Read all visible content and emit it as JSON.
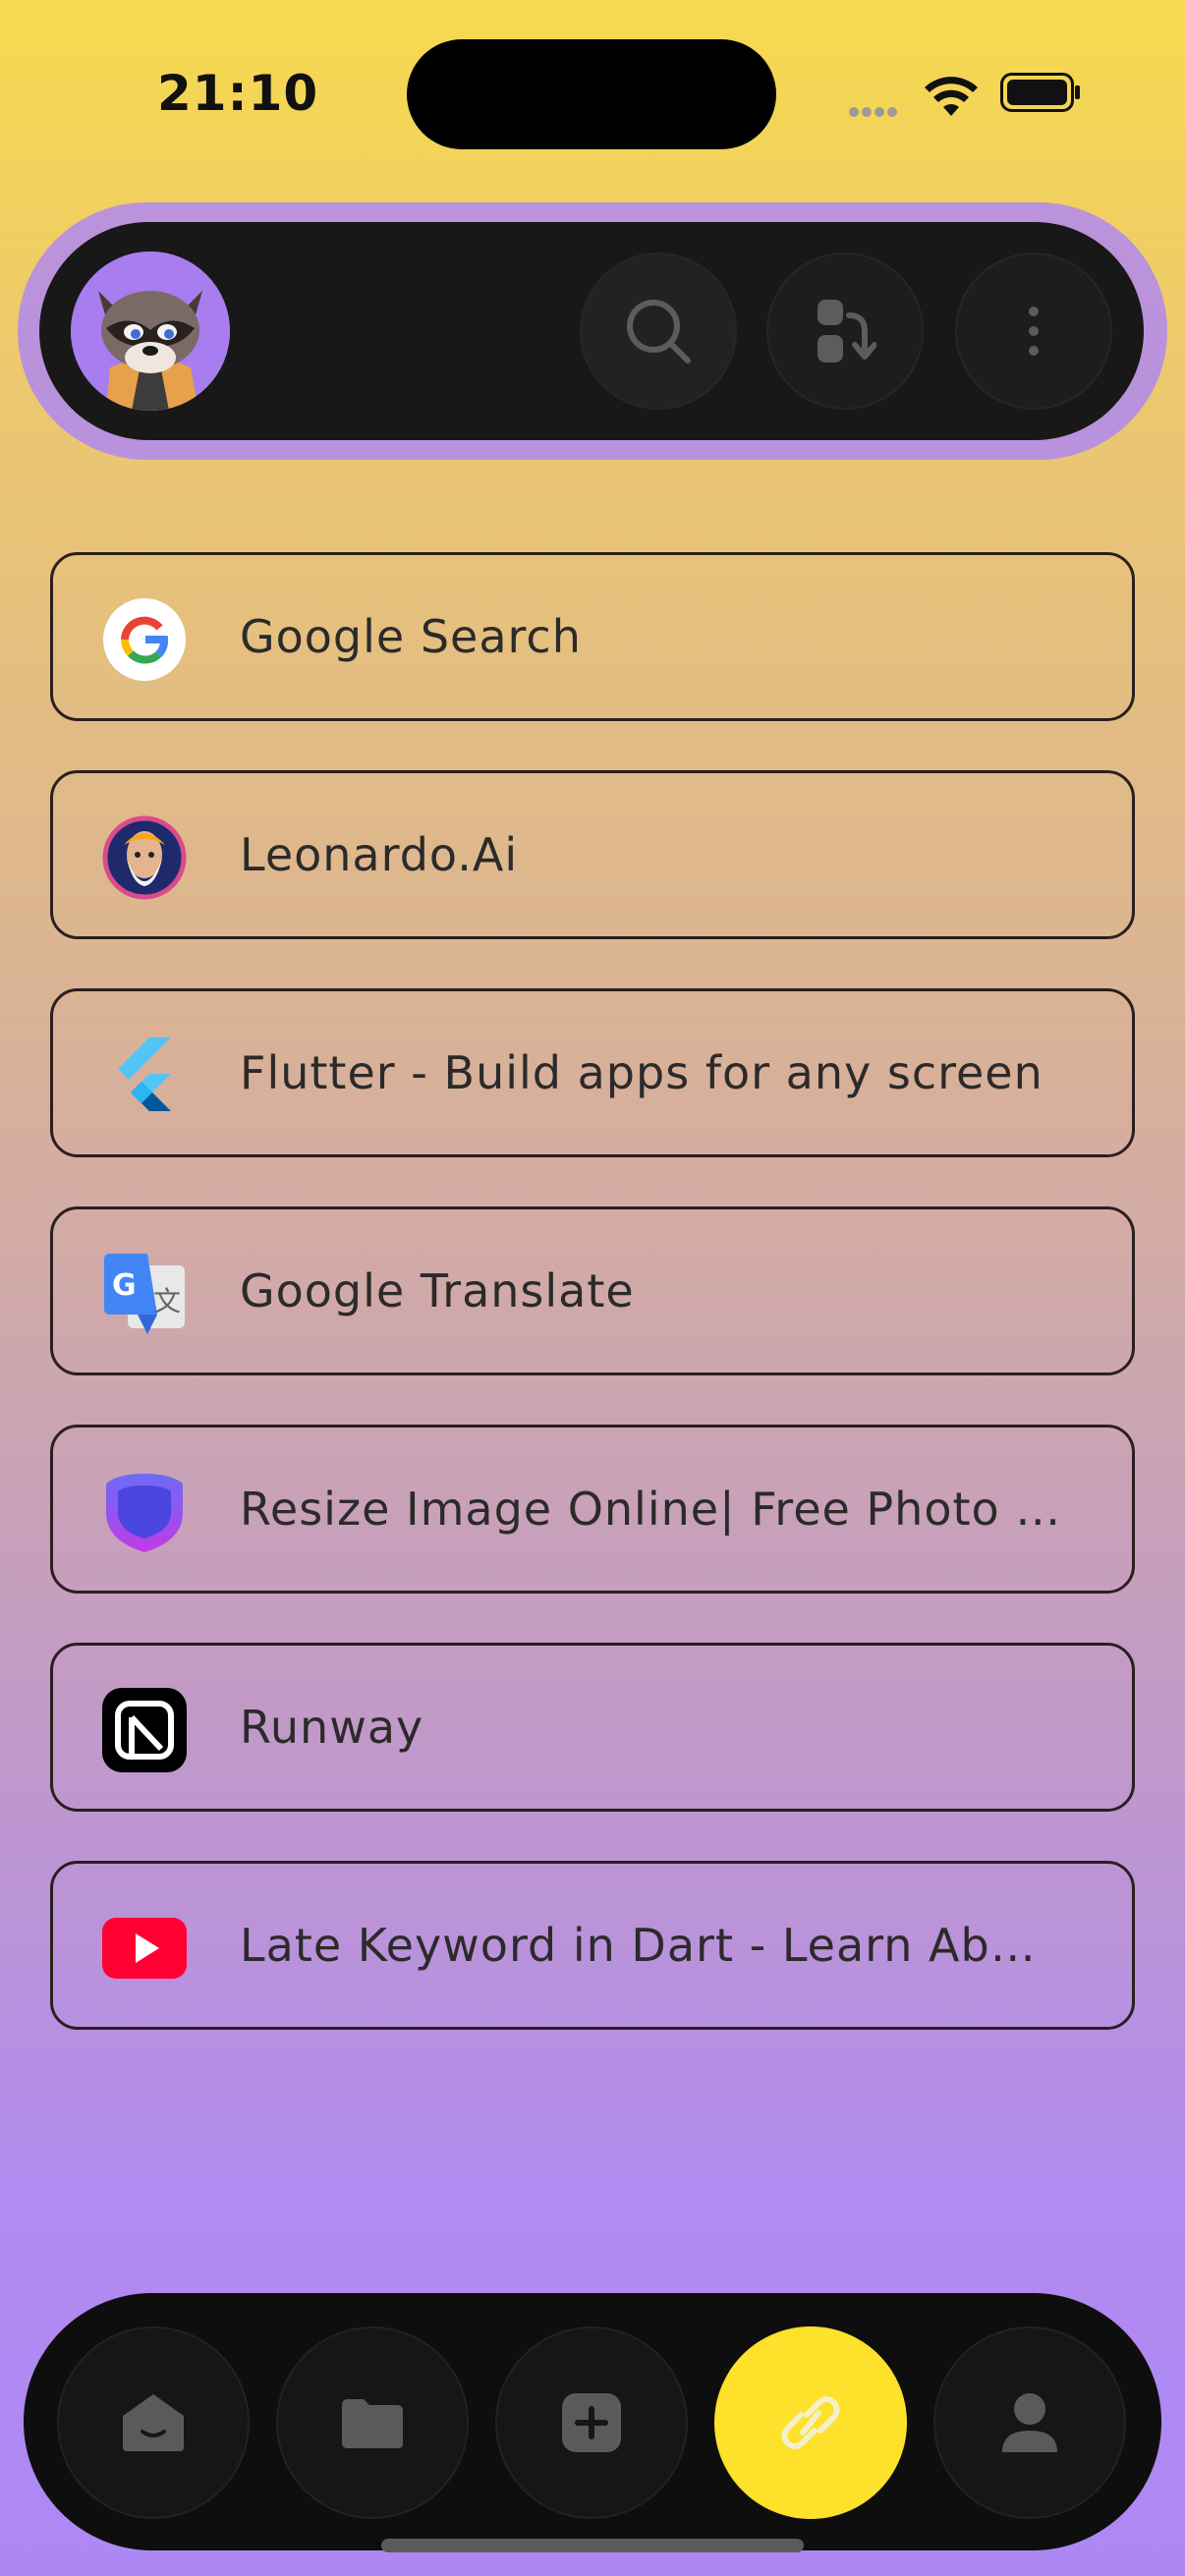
{
  "status": {
    "time": "21:10"
  },
  "links": [
    {
      "label": "Google Search",
      "icon": "google-icon"
    },
    {
      "label": "Leonardo.Ai",
      "icon": "leonardo-icon"
    },
    {
      "label": "Flutter - Build apps for any screen",
      "icon": "flutter-icon"
    },
    {
      "label": "Google Translate",
      "icon": "google-translate-icon"
    },
    {
      "label": "Resize Image Online| Free Photo Resizer",
      "icon": "shield-icon"
    },
    {
      "label": "Runway",
      "icon": "runway-icon"
    },
    {
      "label": "Late Keyword in Dart - Learn About Late Keyword",
      "icon": "youtube-icon"
    }
  ],
  "top_bar": {
    "buttons": [
      "search-icon",
      "sort-icon",
      "more-vertical-icon"
    ]
  },
  "bottom_nav": {
    "items": [
      "home-icon",
      "folder-icon",
      "add-icon",
      "link-icon",
      "profile-icon"
    ],
    "active": "link-icon"
  },
  "colors": {
    "accent": "#fde12a",
    "bar": "#181818",
    "gradient_top": "#f7da4e",
    "gradient_bottom": "#ad88f5"
  }
}
